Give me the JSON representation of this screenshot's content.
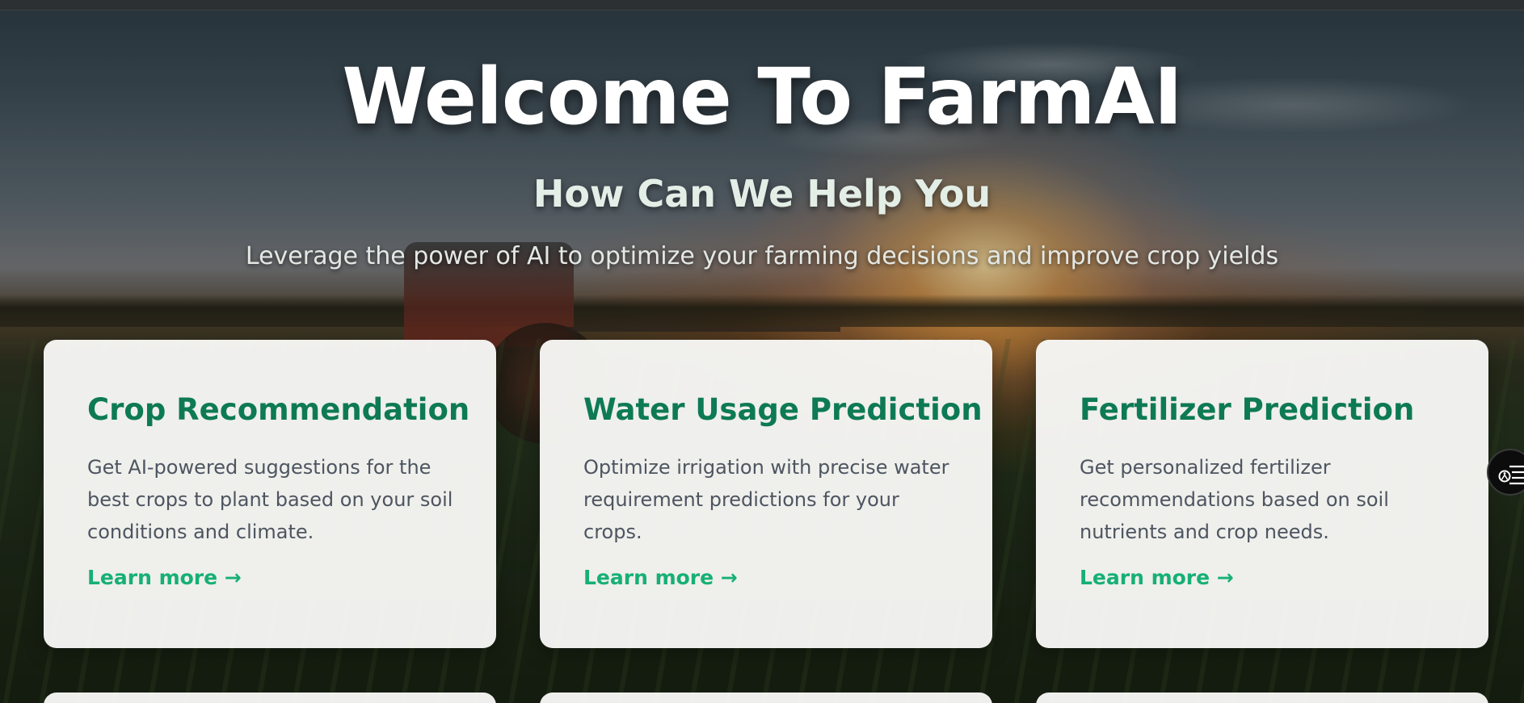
{
  "hero": {
    "title": "Welcome To FarmAI",
    "subtitle": "How Can We Help You",
    "tagline": "Leverage the power of AI to optimize your farming decisions and improve crop yields"
  },
  "cards": [
    {
      "title": "Crop Recommendation",
      "description": "Get AI-powered suggestions for the best crops to plant based on your soil conditions and climate.",
      "link": "Learn more →"
    },
    {
      "title": "Water Usage Prediction",
      "description": "Optimize irrigation with precise water requirement predictions for your crops.",
      "link": "Learn more →"
    },
    {
      "title": "Fertilizer Prediction",
      "description": "Get personalized fertilizer recommendations based on soil nutrients and crop needs.",
      "link": "Learn more →"
    }
  ],
  "side_widget": {
    "icon": "accessibility-menu-icon"
  },
  "colors": {
    "card_title": "#0d7a55",
    "link": "#16b074",
    "card_bg": "#f8f8f6",
    "body_text": "#4d5560"
  }
}
